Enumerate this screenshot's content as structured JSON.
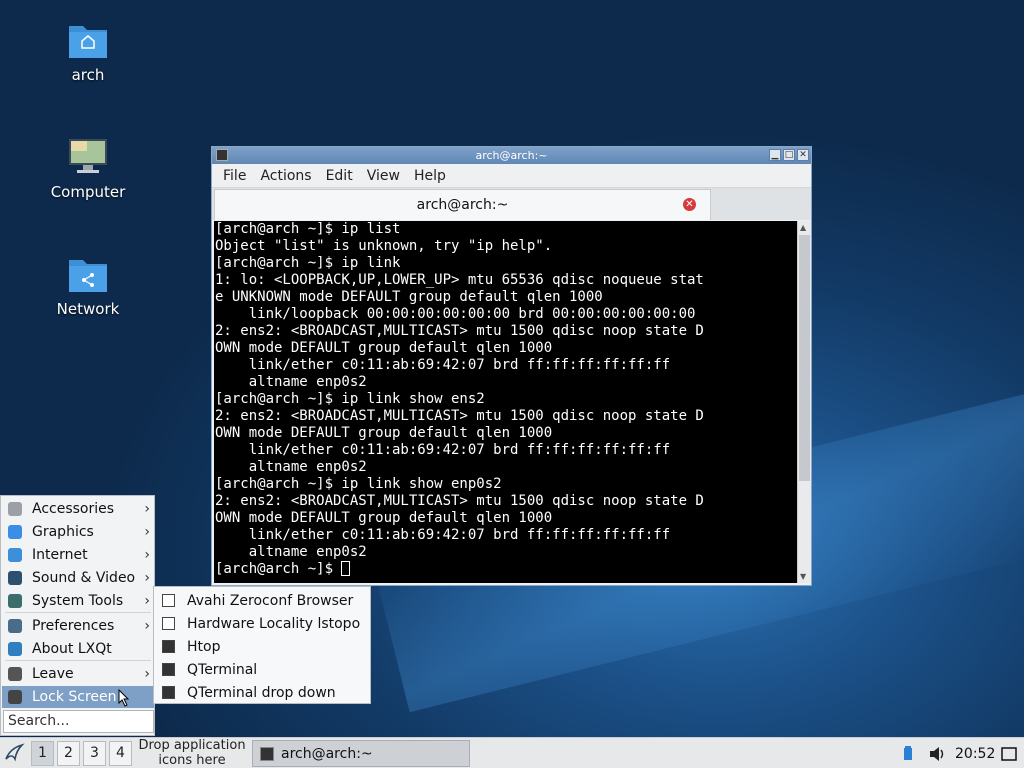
{
  "desktop": {
    "icons": [
      {
        "label": "arch"
      },
      {
        "label": "Computer"
      },
      {
        "label": "Network"
      }
    ]
  },
  "terminal": {
    "window_title": "arch@arch:~",
    "menus": [
      "File",
      "Actions",
      "Edit",
      "View",
      "Help"
    ],
    "tab_label": "arch@arch:~",
    "lines": [
      "[arch@arch ~]$ ip list",
      "Object \"list\" is unknown, try \"ip help\".",
      "[arch@arch ~]$ ip link",
      "1: lo: <LOOPBACK,UP,LOWER_UP> mtu 65536 qdisc noqueue stat",
      "e UNKNOWN mode DEFAULT group default qlen 1000",
      "    link/loopback 00:00:00:00:00:00 brd 00:00:00:00:00:00",
      "2: ens2: <BROADCAST,MULTICAST> mtu 1500 qdisc noop state D",
      "OWN mode DEFAULT group default qlen 1000",
      "    link/ether c0:11:ab:69:42:07 brd ff:ff:ff:ff:ff:ff",
      "    altname enp0s2",
      "[arch@arch ~]$ ip link show ens2",
      "2: ens2: <BROADCAST,MULTICAST> mtu 1500 qdisc noop state D",
      "OWN mode DEFAULT group default qlen 1000",
      "    link/ether c0:11:ab:69:42:07 brd ff:ff:ff:ff:ff:ff",
      "    altname enp0s2",
      "[arch@arch ~]$ ip link show enp0s2",
      "2: ens2: <BROADCAST,MULTICAST> mtu 1500 qdisc noop state D",
      "OWN mode DEFAULT group default qlen 1000",
      "    link/ether c0:11:ab:69:42:07 brd ff:ff:ff:ff:ff:ff",
      "    altname enp0s2"
    ],
    "prompt": "[arch@arch ~]$ "
  },
  "start_menu": {
    "items": [
      {
        "label": "Accessories",
        "color": "#9aa0a6",
        "submenu": true
      },
      {
        "label": "Graphics",
        "color": "#3a8ee6",
        "submenu": true
      },
      {
        "label": "Internet",
        "color": "#3c8fd8",
        "submenu": true
      },
      {
        "label": "Sound & Video",
        "color": "#2f4f6f",
        "submenu": true
      },
      {
        "label": "System Tools",
        "color": "#3b6e6a",
        "submenu": true
      },
      {
        "label": "Preferences",
        "color": "#4a6c8a",
        "submenu": true
      },
      {
        "label": "About LXQt",
        "color": "#2f7fc0",
        "submenu": false
      },
      {
        "label": "Leave",
        "color": "#555555",
        "submenu": true
      },
      {
        "label": "Lock Screen",
        "color": "#444444",
        "submenu": false
      }
    ],
    "search_placeholder": "Search..."
  },
  "system_tools_submenu": {
    "items": [
      {
        "label": "Avahi Zeroconf Browser"
      },
      {
        "label": "Hardware Locality lstopo"
      },
      {
        "label": "Htop"
      },
      {
        "label": "QTerminal"
      },
      {
        "label": "QTerminal drop down"
      }
    ]
  },
  "taskbar": {
    "desktops": [
      "1",
      "2",
      "3",
      "4"
    ],
    "drop_hint": "Drop application icons here",
    "task_label": "arch@arch:~",
    "clock": "20:52"
  }
}
